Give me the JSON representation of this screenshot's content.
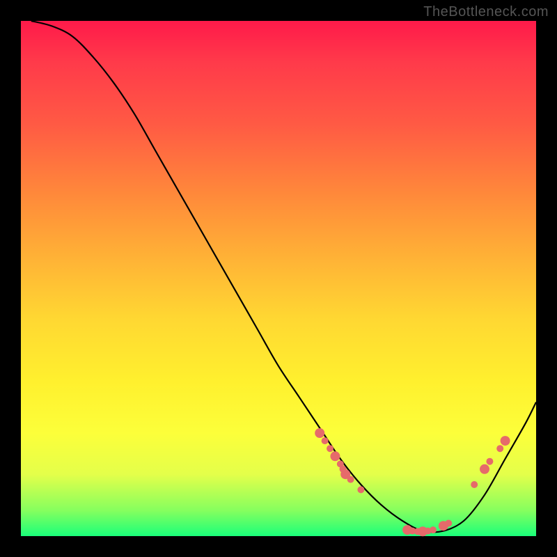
{
  "watermark": "TheBottleneck.com",
  "chart_data": {
    "type": "line",
    "title": "",
    "xlabel": "",
    "ylabel": "",
    "xlim": [
      0,
      100
    ],
    "ylim": [
      0,
      100
    ],
    "x": [
      2,
      6,
      10,
      14,
      18,
      22,
      26,
      30,
      34,
      38,
      42,
      46,
      50,
      54,
      58,
      62,
      66,
      70,
      74,
      78,
      82,
      86,
      90,
      94,
      98,
      100
    ],
    "y": [
      100,
      99,
      97,
      93,
      88,
      82,
      75,
      68,
      61,
      54,
      47,
      40,
      33,
      27,
      21,
      15,
      10,
      6,
      3,
      1,
      1,
      3,
      8,
      15,
      22,
      26
    ],
    "markers": {
      "x": [
        58,
        59,
        60,
        61,
        62,
        62.5,
        63,
        64,
        66,
        75,
        76,
        77,
        78,
        79,
        80,
        82,
        83,
        88,
        90,
        91,
        93,
        94
      ],
      "y": [
        20,
        18.5,
        17,
        15.5,
        14,
        13,
        12,
        11,
        9,
        1.2,
        1,
        0.9,
        0.9,
        1,
        1.2,
        2,
        2.5,
        10,
        13,
        14.5,
        17,
        18.5
      ]
    }
  }
}
